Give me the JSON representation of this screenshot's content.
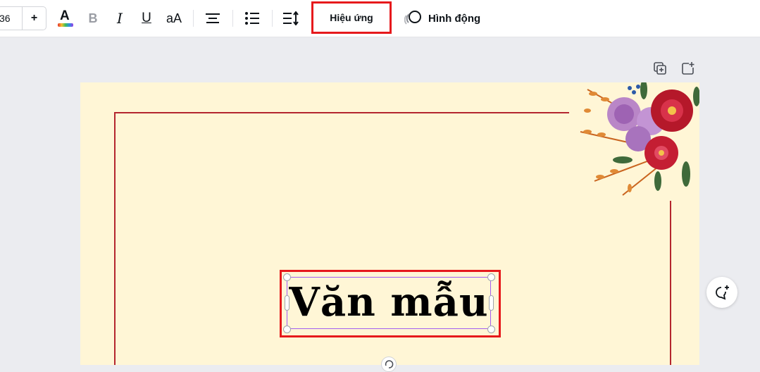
{
  "toolbar": {
    "font_size": "36",
    "increase_label": "+",
    "text_color_letter": "A",
    "bold_letter": "B",
    "italic_letter": "I",
    "underline_letter": "U",
    "case_label": "aA",
    "effects_label": "Hiệu ứng",
    "animate_label": "Hình động"
  },
  "canvas": {
    "title_text": "Văn mẫu"
  },
  "colors": {
    "page_background": "#fff6d6",
    "frame": "#b4262f",
    "highlight_box": "#e6191c",
    "selection": "#a35ef0"
  }
}
